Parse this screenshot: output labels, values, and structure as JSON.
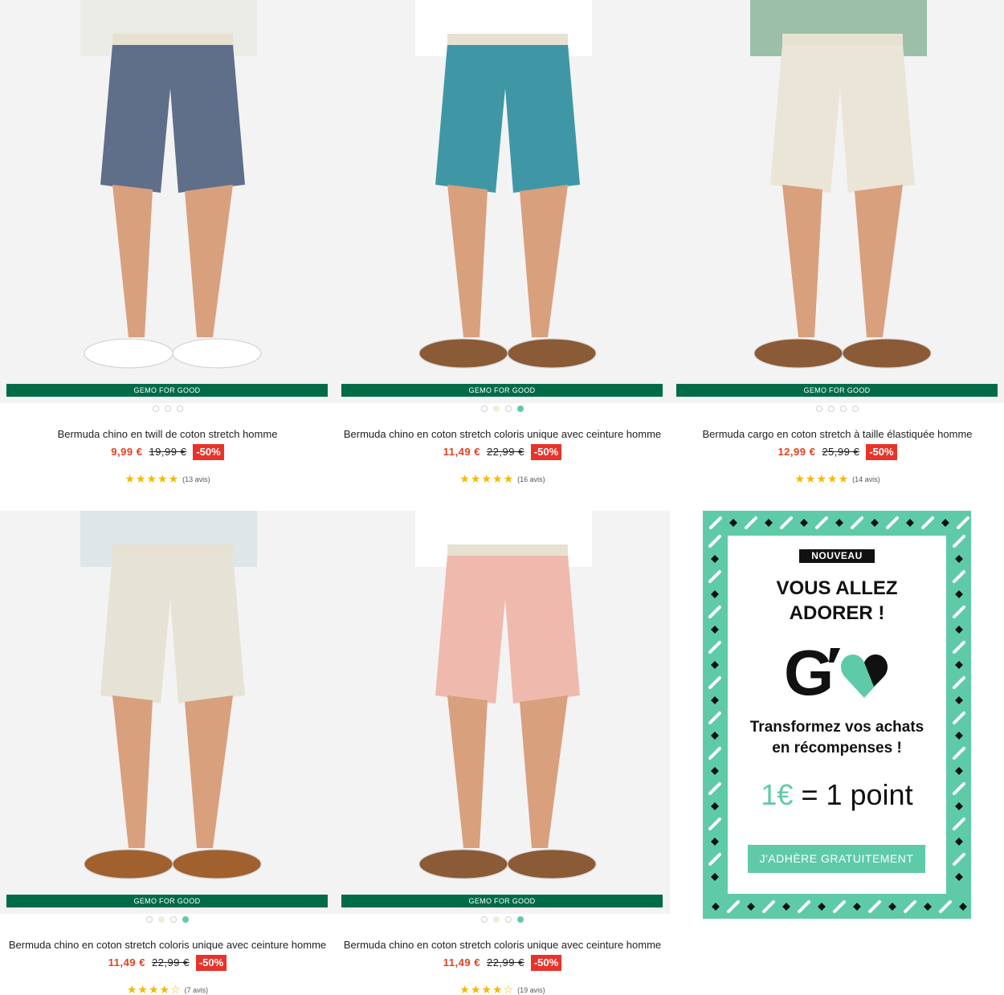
{
  "products": [
    {
      "badge": "GEMO FOR GOOD",
      "name": "Bermuda chino en twill de coton stretch homme",
      "price": "9,99 €",
      "old_price": "19,99 €",
      "discount": "-50%",
      "rating_stars": "★★★★★",
      "reviews": "(13 avis)",
      "short_color": "#5f6f8a",
      "top_color": "#ecece6",
      "shoe_color": "#ffffff",
      "swatches": [
        "#ffffff",
        "#ffffff",
        "#ffffff"
      ]
    },
    {
      "badge": "GEMO FOR GOOD",
      "name": "Bermuda chino en coton stretch coloris unique avec ceinture homme",
      "price": "11,49 €",
      "old_price": "22,99 €",
      "discount": "-50%",
      "rating_stars": "★★★★★",
      "reviews": "(16 avis)",
      "short_color": "#3f97a6",
      "top_color": "#ffffff",
      "shoe_color": "#8b5a36",
      "swatches": [
        "#ffffff",
        "#f1ecd8",
        "#ffffff",
        "#5fcaa8"
      ]
    },
    {
      "badge": "GEMO FOR GOOD",
      "name": "Bermuda cargo en coton stretch à taille élastiquée homme",
      "price": "12,99 €",
      "old_price": "25,99 €",
      "discount": "-50%",
      "rating_stars": "★★★★★",
      "reviews": "(14 avis)",
      "short_color": "#ebe5d7",
      "top_color": "#9bbfa8",
      "shoe_color": "#8b5a36",
      "swatches": [
        "#ffffff",
        "#ffffff",
        "#ffffff",
        "#ffffff"
      ]
    },
    {
      "badge": "GEMO FOR GOOD",
      "name": "Bermuda chino en coton stretch coloris unique avec ceinture homme",
      "price": "11,49 €",
      "old_price": "22,99 €",
      "discount": "-50%",
      "rating_stars": "★★★★☆",
      "reviews": "(7 avis)",
      "short_color": "#e6e3d6",
      "top_color": "#dfe6ea",
      "shoe_color": "#a0612f",
      "swatches": [
        "#ffffff",
        "#f1ecd8",
        "#ffffff",
        "#5fcaa8"
      ]
    },
    {
      "badge": "GEMO FOR GOOD",
      "name": "Bermuda chino en coton stretch coloris unique avec ceinture homme",
      "price": "11,49 €",
      "old_price": "22,99 €",
      "discount": "-50%",
      "rating_stars": "★★★★☆",
      "reviews": "(19 avis)",
      "short_color": "#efb9ad",
      "top_color": "#ffffff",
      "shoe_color": "#8b5a36",
      "swatches": [
        "#ffffff",
        "#f1ecd8",
        "#ffffff",
        "#5fcaa8"
      ]
    }
  ],
  "promo": {
    "tag": "NOUVEAU",
    "title_line1": "VOUS ALLEZ",
    "title_line2": "ADORER !",
    "logo_letter": "G",
    "sub_line1": "Transformez vos achats",
    "sub_line2": "en récompenses !",
    "ratio_left": "1€",
    "ratio_right": "= 1 point",
    "button": "J'ADHÈRE GRATUITEMENT",
    "accent": "#5fcaa8"
  },
  "colors": {
    "badge_green": "#006b47",
    "price_red": "#e2401f",
    "discount_red": "#e8332a",
    "star": "#f5b800"
  }
}
